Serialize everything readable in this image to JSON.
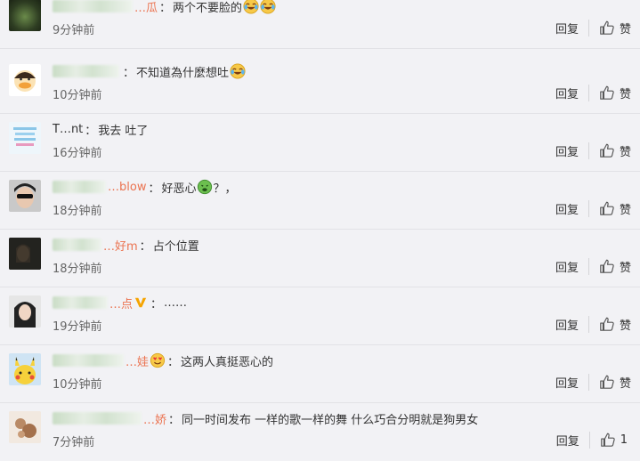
{
  "comments": [
    {
      "name_visible": "…瓜",
      "sep": "：",
      "text": "两个不要脸的",
      "time": "9分钟前",
      "reply": "回复",
      "like": "赞"
    },
    {
      "name_visible": "",
      "sep": "：",
      "text": "不知道為什麼想吐",
      "time": "10分钟前",
      "reply": "回复",
      "like": "赞"
    },
    {
      "name_visible": "T…nt",
      "sep": "：",
      "text": "我去 吐了",
      "time": "16分钟前",
      "reply": "回复",
      "like": "赞"
    },
    {
      "name_visible": "…blow",
      "sep": "：",
      "text": "好恶心",
      "text_after": "？，",
      "time": "18分钟前",
      "reply": "回复",
      "like": "赞"
    },
    {
      "name_visible": "…好m",
      "sep": "：",
      "text": "占个位置",
      "time": "18分钟前",
      "reply": "回复",
      "like": "赞"
    },
    {
      "name_visible": "…点",
      "sep": "：",
      "text": "……",
      "time": "19分钟前",
      "reply": "回复",
      "like": "赞"
    },
    {
      "name_visible": "…娃",
      "sep": "：",
      "text": "这两人真挺恶心的",
      "time": "10分钟前",
      "reply": "回复",
      "like": "赞"
    },
    {
      "name_visible": "…娇",
      "sep": "：",
      "text": "同一时间发布 一样的歌一样的舞 什么巧合分明就是狗男女",
      "time": "7分钟前",
      "reply": "回复",
      "like": "1"
    }
  ],
  "colors": {
    "username": "#eb7350",
    "text": "#333333",
    "time": "#666666",
    "background": "#f2f2f5"
  },
  "icons": {
    "like": "thumbs-up-icon",
    "laugh_cry": "laugh-cry-emoji-icon",
    "sick": "sick-emoji-icon",
    "verified": "verified-v-icon",
    "heart_eyes": "heart-eyes-emoji-icon"
  }
}
